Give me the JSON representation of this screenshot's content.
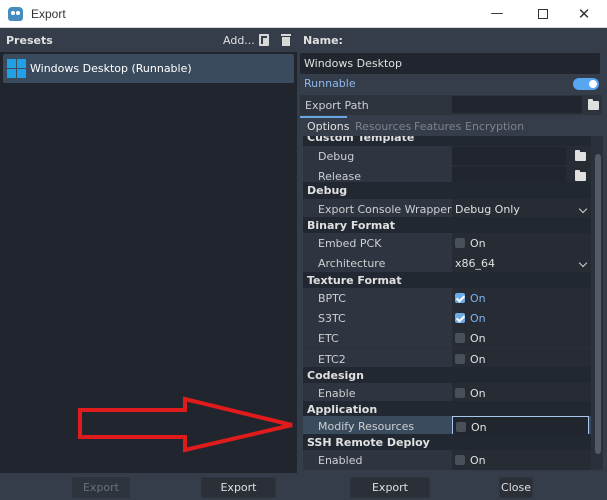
{
  "window": {
    "title": "Export",
    "min_glyph": "—",
    "close_glyph": "✕"
  },
  "presets": {
    "label": "Presets",
    "add_label": "Add...",
    "items": [
      {
        "label": "Windows Desktop (Runnable)"
      }
    ]
  },
  "details": {
    "name_label": "Name:",
    "name_value": "Windows Desktop",
    "runnable_label": "Runnable",
    "runnable_on": true,
    "export_path_label": "Export Path",
    "export_path_value": ""
  },
  "tabs": [
    "Options",
    "Resources",
    "Features",
    "Encryption"
  ],
  "options": {
    "custom_template": {
      "title": "Custom Template",
      "debug": "Debug",
      "release": "Release"
    },
    "debug": {
      "title": "Debug",
      "console_wrapper_label": "Export Console Wrapper",
      "console_wrapper_value": "Debug Only"
    },
    "binary_format": {
      "title": "Binary Format",
      "embed_pck_label": "Embed PCK",
      "embed_pck_value": "On",
      "architecture_label": "Architecture",
      "architecture_value": "x86_64"
    },
    "texture_format": {
      "title": "Texture Format",
      "bptc_label": "BPTC",
      "bptc_value": "On",
      "s3tc_label": "S3TC",
      "s3tc_value": "On",
      "etc_label": "ETC",
      "etc_value": "On",
      "etc2_label": "ETC2",
      "etc2_value": "On"
    },
    "codesign": {
      "title": "Codesign",
      "enable_label": "Enable",
      "enable_value": "On"
    },
    "application": {
      "title": "Application",
      "modify_label": "Modify Resources",
      "modify_value": "On"
    },
    "ssh": {
      "title": "SSH Remote Deploy",
      "enabled_label": "Enabled",
      "enabled_value": "On"
    }
  },
  "buttons": {
    "export_all": "Export All...",
    "export_project": "Export Project...",
    "export_pck": "Export PCK/ZIP...",
    "close": "Close"
  },
  "colors": {
    "accent": "#58a6f0",
    "annotation_arrow": "#e01b1b"
  }
}
